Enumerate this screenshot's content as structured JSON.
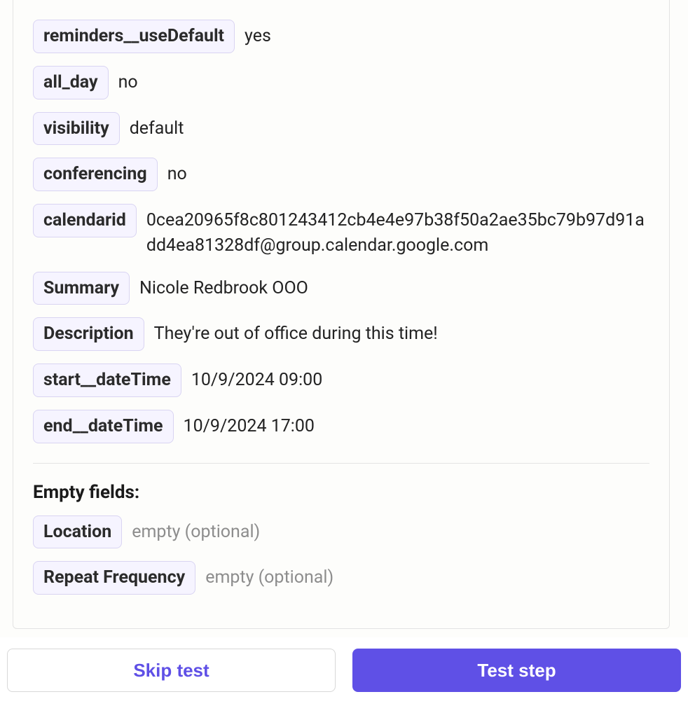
{
  "fields": {
    "reminders_useDefault": {
      "label": "reminders__useDefault",
      "value": "yes"
    },
    "all_day": {
      "label": "all_day",
      "value": "no"
    },
    "visibility": {
      "label": "visibility",
      "value": "default"
    },
    "conferencing": {
      "label": "conferencing",
      "value": "no"
    },
    "calendarid": {
      "label": "calendarid",
      "value": "0cea20965f8c801243412cb4e4e97b38f50a2ae35bc79b97d91add4ea81328df@group.calendar.google.com"
    },
    "summary": {
      "label": "Summary",
      "value": "Nicole Redbrook OOO"
    },
    "description": {
      "label": "Description",
      "value": "They're out of office during this time!"
    },
    "start_dateTime": {
      "label": "start__dateTime",
      "value": "10/9/2024 09:00"
    },
    "end_dateTime": {
      "label": "end__dateTime",
      "value": "10/9/2024 17:00"
    }
  },
  "emptySection": {
    "heading": "Empty fields:",
    "location": {
      "label": "Location",
      "value": "empty (optional)"
    },
    "repeatFrequency": {
      "label": "Repeat Frequency",
      "value": "empty (optional)"
    }
  },
  "footer": {
    "skip": "Skip test",
    "test": "Test step"
  }
}
